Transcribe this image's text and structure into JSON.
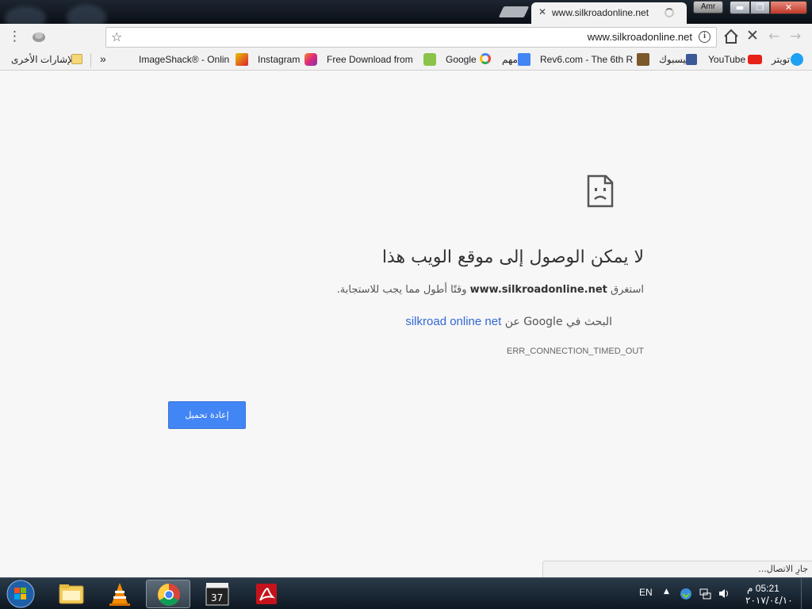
{
  "window": {
    "tab_title": "www.silkroadonline.net",
    "profile_name": "Amr",
    "minimize_symbol": "▬",
    "maximize_symbol": "❐",
    "close_symbol": "✕"
  },
  "toolbar": {
    "url": "www.silkroadonline.net",
    "info_symbol": "i"
  },
  "bookmarks": {
    "other_bookmarks": "الإشارات الأخرى",
    "overflow": "»",
    "items": [
      {
        "label": "ImageShack® - Onlin",
        "icon": "imageshack-icon"
      },
      {
        "label": "Instagram",
        "icon": "instagram-icon"
      },
      {
        "label": "Free Download from",
        "icon": "android-download-icon"
      },
      {
        "label": "Google",
        "icon": "google-icon"
      },
      {
        "label": "مهم",
        "icon": "translate-icon"
      },
      {
        "label": "Rev6.com - The 6th R",
        "icon": "rev6-icon"
      },
      {
        "label": "فيسبوك",
        "icon": "facebook-icon"
      },
      {
        "label": "YouTube",
        "icon": "youtube-icon"
      },
      {
        "label": "تويتر",
        "icon": "twitter-icon"
      }
    ]
  },
  "error_page": {
    "heading": "لا يمكن الوصول إلى موقع الويب هذا",
    "desc_prefix": "استغرق",
    "desc_host": "www.silkroadonline.net",
    "desc_suffix": "وقتًا أطول مما يجب للاستجابة.",
    "search_prefix": "البحث في Google عن",
    "search_query": "silkroad online net",
    "error_code": "ERR_CONNECTION_TIMED_OUT",
    "reload_label": "إعادة تحميل"
  },
  "status": {
    "text": "جارِ الاتصال..."
  },
  "taskbar": {
    "apps": [
      "file-explorer",
      "vlc",
      "google-chrome",
      "video-editor",
      "adobe-acrobat"
    ],
    "language": "EN",
    "time": "05:21 م",
    "date": "٢٠١٧/٠٤/١٠"
  },
  "colors": {
    "reload_button": "#4285f4",
    "link": "#3367d6",
    "page_background": "#f7f7f7"
  }
}
